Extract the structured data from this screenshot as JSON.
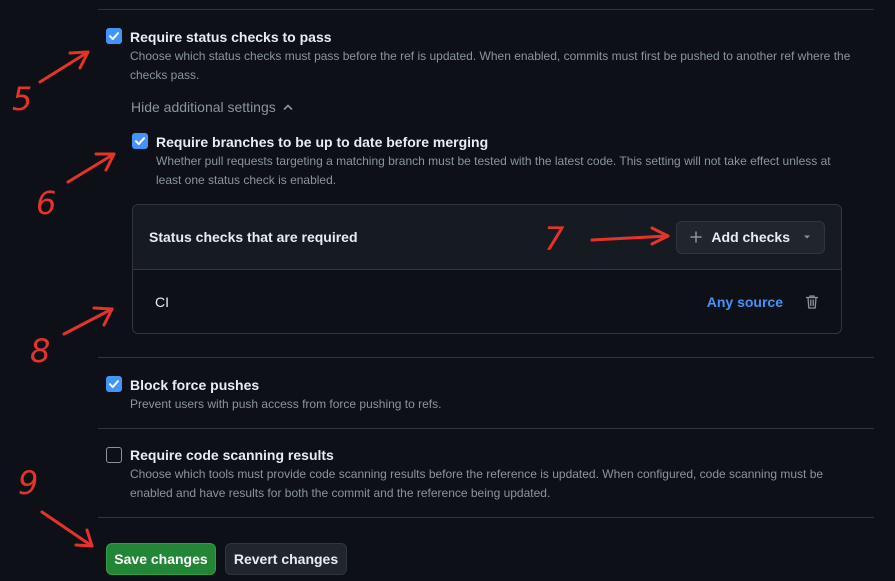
{
  "rules": {
    "status_checks": {
      "title": "Require status checks to pass",
      "description": "Choose which status checks must pass before the ref is updated. When enabled, commits must first be pushed to another ref where the checks pass.",
      "checked": true
    },
    "hide_settings_label": "Hide additional settings",
    "up_to_date": {
      "title": "Require branches to be up to date before merging",
      "description": "Whether pull requests targeting a matching branch must be tested with the latest code. This setting will not take effect unless at least one status check is enabled.",
      "checked": true
    },
    "required_checks": {
      "header": "Status checks that are required",
      "add_checks_label": "Add checks",
      "rows": [
        {
          "name": "CI",
          "source": "Any source"
        }
      ]
    },
    "block_force_pushes": {
      "title": "Block force pushes",
      "description": "Prevent users with push access from force pushing to refs.",
      "checked": true
    },
    "code_scanning": {
      "title": "Require code scanning results",
      "description": "Choose which tools must provide code scanning results before the reference is updated. When configured, code scanning must be enabled and have results for both the commit and the reference being updated.",
      "checked": false
    }
  },
  "actions": {
    "save_label": "Save changes",
    "revert_label": "Revert changes"
  },
  "annotations": {
    "marker_5": "5",
    "marker_6": "6",
    "marker_7": "7",
    "marker_8": "8",
    "marker_9": "9",
    "color": "#e5332a"
  },
  "colors": {
    "accent": "#4493f8",
    "save_green": "#238636",
    "background": "#0d1117"
  }
}
